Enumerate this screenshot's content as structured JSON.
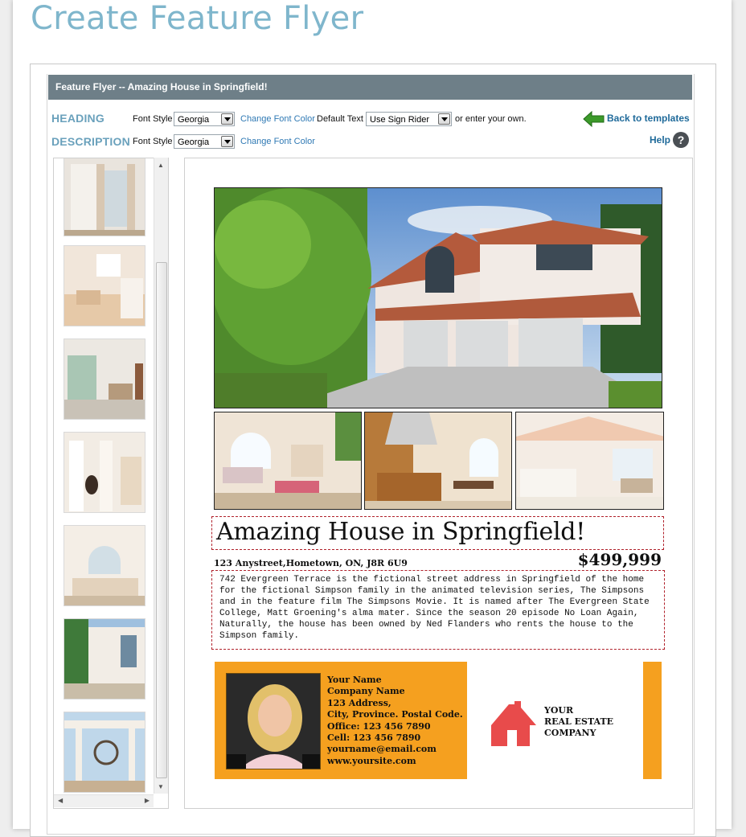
{
  "page": {
    "title": "Create Feature Flyer"
  },
  "panel": {
    "title": "Feature Flyer -- Amazing House in Springfield!"
  },
  "heading_row": {
    "label": "HEADING",
    "font_style_label": "Font Style",
    "font_style_value": "Georgia",
    "change_color_link": "Change Font Color",
    "default_text_label": "Default Text",
    "default_text_value": "Use Sign Rider",
    "enter_own_text": "or enter your own."
  },
  "description_row": {
    "label": "DESCRIPTION",
    "font_style_label": "Font Style",
    "font_style_value": "Georgia",
    "change_color_link": "Change Font Color"
  },
  "nav": {
    "back_label": "Back to templates",
    "help_label": "Help",
    "help_glyph": "?"
  },
  "flyer": {
    "headline": "Amazing House in Springfield!",
    "address": "123 Anystreet,Hometown, ON, J8R 6U9",
    "price": "$499,999",
    "description": "742 Evergreen Terrace is the fictional street address in Springfield of the home for the fictional Simpson family in the animated television series, The Simpsons and in the feature film The Simpsons Movie. It is named after The Evergreen State College, Matt Groening's alma mater. Since the season 20 episode No Loan Again, Naturally, the house has been owned by Ned Flanders who rents the house to the Simpson family.",
    "agent": {
      "name": "Your Name",
      "company": "Company Name",
      "address": "123 Address,",
      "city": "City, Province. Postal Code.",
      "office": "Office: 123 456 7890",
      "cell": "Cell: 123 456 7890",
      "email": "yourname@email.com",
      "website": "www.yoursite.com"
    },
    "company_line1": "YOUR",
    "company_line2": "REAL ESTATE",
    "company_line3": "COMPANY"
  },
  "colors": {
    "title": "#7fb6cc",
    "title_bar": "#6e7f88",
    "row_label": "#6aa1bc",
    "link": "#2f79b4",
    "agent_card": "#f5a01f",
    "logo_red": "#e84b4b",
    "edit_border": "#b0202a"
  }
}
